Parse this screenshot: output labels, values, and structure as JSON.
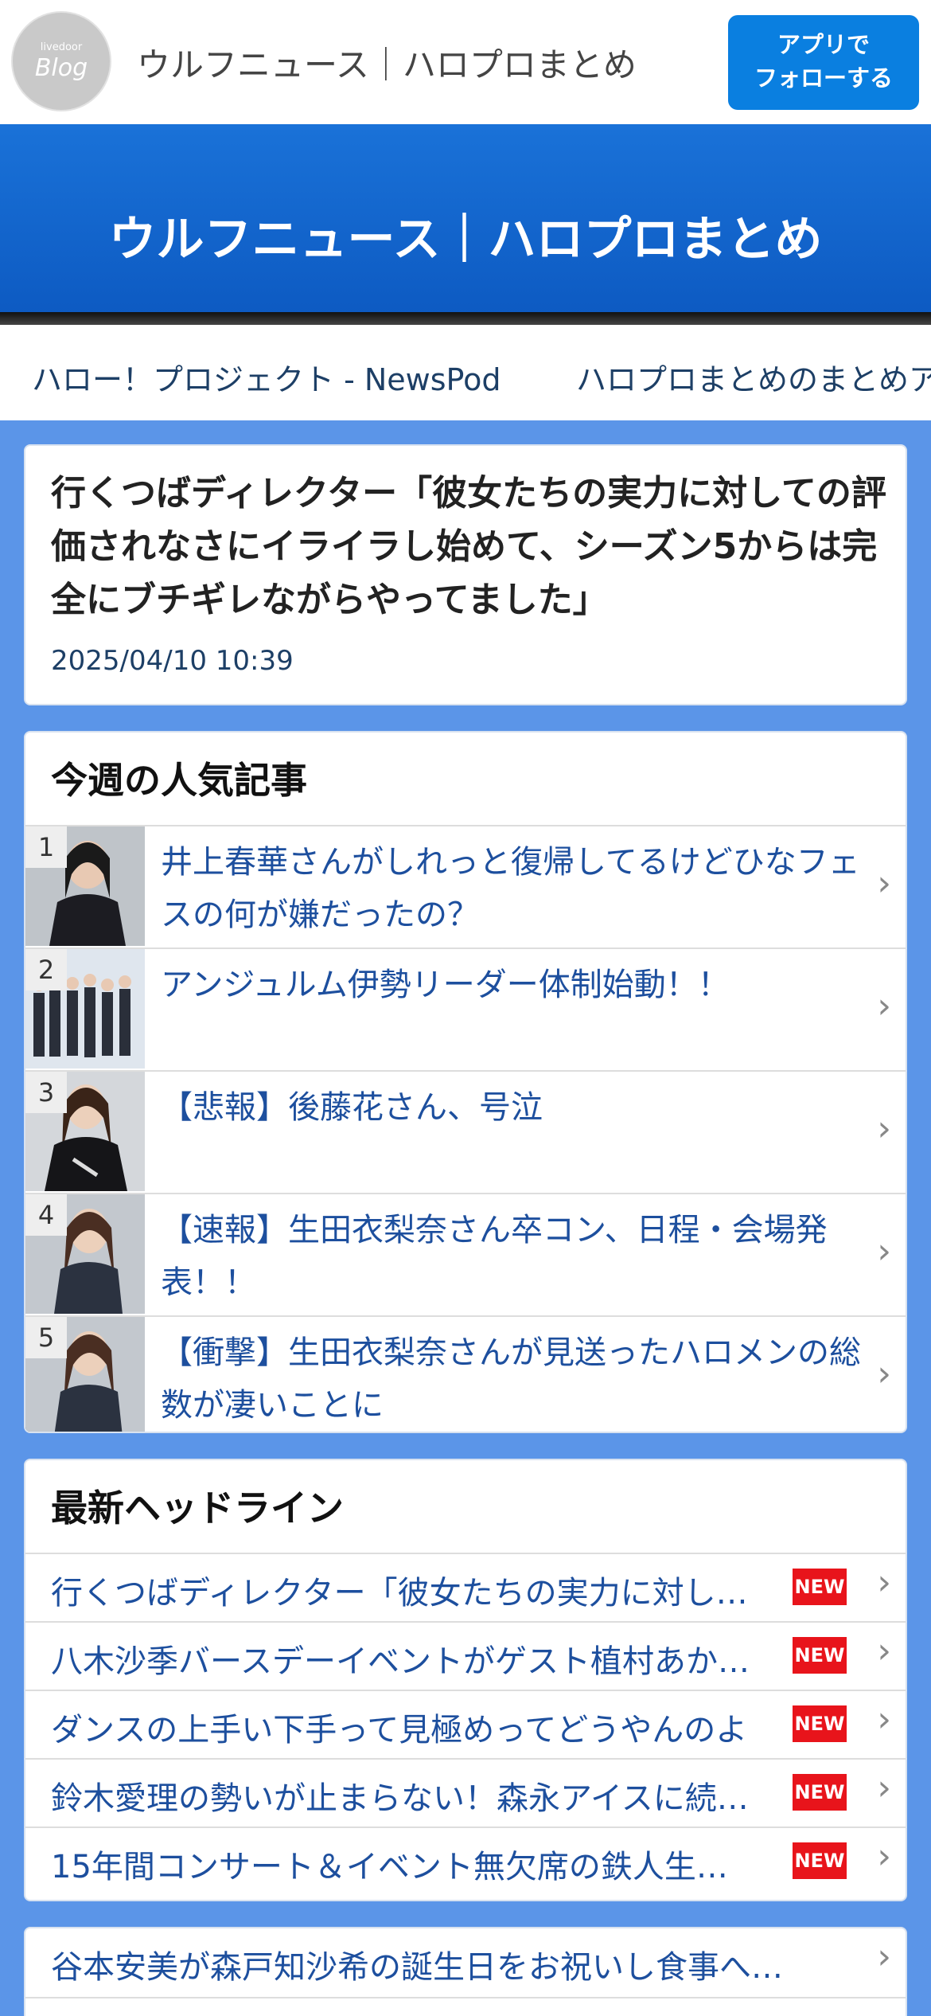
{
  "header": {
    "logo_small": "livedoor",
    "logo_big": "Blog",
    "title": "ウルフニュース｜ハロプロまとめ",
    "follow_line1": "アプリで",
    "follow_line2": "フォローする"
  },
  "banner": {
    "title": "ウルフニュース｜ハロプロまとめ"
  },
  "nav": {
    "links": [
      "ハロー！プロジェクト - NewsPod",
      "ハロプロまとめのまとめア"
    ]
  },
  "article": {
    "title": "行くつばディレクター「彼女たちの実力に対しての評価されなさにイライラし始めて、シーズン5からは完全にブチギレながらやってました」",
    "date": "2025/04/10 10:39"
  },
  "popular": {
    "heading": "今週の人気記事",
    "items": [
      {
        "rank": "1",
        "text": "井上春華さんがしれっと復帰してるけどひなフェスの何が嫌だったの？"
      },
      {
        "rank": "2",
        "text": "アンジュルム伊勢リーダー体制始動！！"
      },
      {
        "rank": "3",
        "text": "【悲報】後藤花さん、号泣"
      },
      {
        "rank": "4",
        "text": "【速報】生田衣梨奈さん卒コン、日程・会場発表！！"
      },
      {
        "rank": "5",
        "text": "【衝撃】生田衣梨奈さんが見送ったハロメンの総数が凄いことに"
      }
    ]
  },
  "headlines": {
    "heading": "最新ヘッドライン",
    "new_label": "NEW",
    "items": [
      "行くつばディレクター「彼女たちの実力に対し…",
      "八木沙季バースデーイベントがゲスト植村あか…",
      "ダンスの上手い下手って見極めってどうやんのよ",
      "鈴木愛理の勢いが止まらない！森永アイスに続…",
      "15年間コンサート＆イベント無欠席の鉄人生…"
    ]
  },
  "more": {
    "items": [
      "谷本安美が森戸知沙希の誕生日をお祝いし食事へ…"
    ]
  }
}
